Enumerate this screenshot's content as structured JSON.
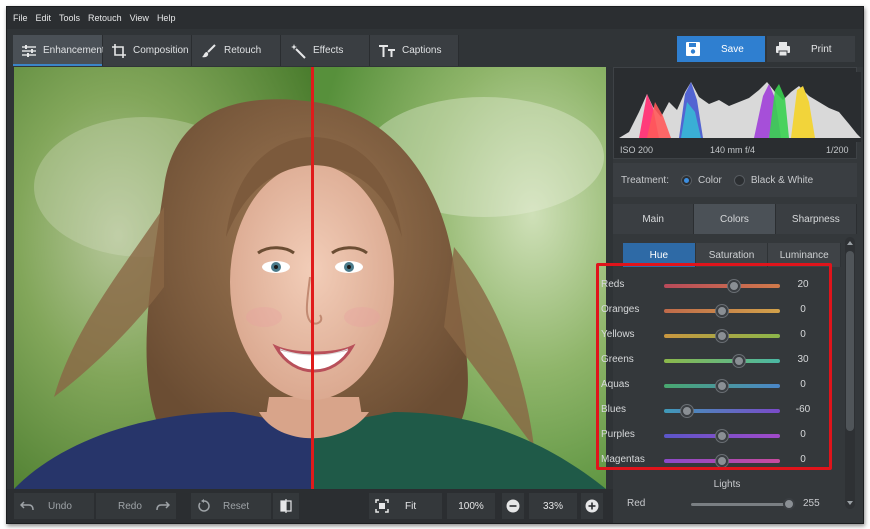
{
  "menu": [
    "File",
    "Edit",
    "Tools",
    "Retouch",
    "View",
    "Help"
  ],
  "tabs": [
    {
      "label": "Enhancement",
      "active": true
    },
    {
      "label": "Composition",
      "active": false
    },
    {
      "label": "Retouch",
      "active": false
    },
    {
      "label": "Effects",
      "active": false
    },
    {
      "label": "Captions",
      "active": false
    }
  ],
  "save_label": "Save",
  "print_label": "Print",
  "bottom": {
    "undo": "Undo",
    "redo": "Redo",
    "reset": "Reset",
    "fit": "Fit",
    "zoom_100": "100%",
    "zoom_value": "33%"
  },
  "histogram": {
    "iso": "ISO 200",
    "lens": "140 mm f/4",
    "shutter": "1/200"
  },
  "treatment": {
    "label": "Treatment:",
    "options": [
      "Color",
      "Black & White"
    ],
    "selected": "Color"
  },
  "panel_tabs": [
    {
      "label": "Main",
      "active": false
    },
    {
      "label": "Colors",
      "active": true
    },
    {
      "label": "Sharpness",
      "active": false
    }
  ],
  "sub_tabs": [
    {
      "label": "Hue",
      "active": true
    },
    {
      "label": "Saturation",
      "active": false
    },
    {
      "label": "Luminance",
      "active": false
    }
  ],
  "hue_sliders": [
    {
      "label": "Reds",
      "value": "20"
    },
    {
      "label": "Oranges",
      "value": "0"
    },
    {
      "label": "Yellows",
      "value": "0"
    },
    {
      "label": "Greens",
      "value": "30"
    },
    {
      "label": "Aquas",
      "value": "0"
    },
    {
      "label": "Blues",
      "value": "-60"
    },
    {
      "label": "Purples",
      "value": "0"
    },
    {
      "label": "Magentas",
      "value": "0"
    }
  ],
  "lights": {
    "heading": "Lights",
    "red_label": "Red",
    "red_value": "255"
  },
  "colors": {
    "accent": "#2f7fd0",
    "compare_divider": "#e01b1b",
    "highlight_box": "#e0141b"
  }
}
